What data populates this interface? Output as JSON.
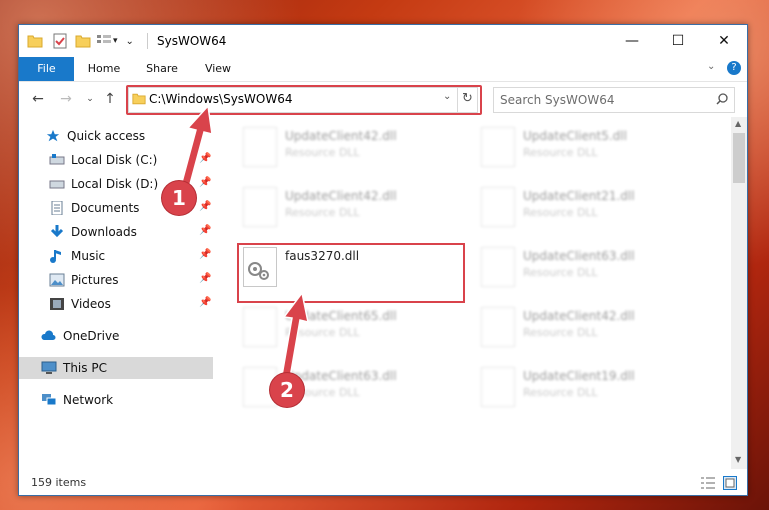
{
  "window": {
    "title": "SysWOW64",
    "controls": {
      "minimize": "—",
      "maximize": "☐",
      "close": "✕"
    }
  },
  "ribbon": {
    "tabs": [
      "File",
      "Home",
      "Share",
      "View"
    ],
    "help_icon": "?"
  },
  "nav": {
    "address": "C:\\Windows\\SysWOW64",
    "search_placeholder": "Search SysWOW64"
  },
  "sidebar": {
    "quick_access": "Quick access",
    "items": [
      {
        "label": "Local Disk (C:)",
        "icon": "drive-icon",
        "pinned": true
      },
      {
        "label": "Local Disk (D:)",
        "icon": "drive-icon",
        "pinned": true
      },
      {
        "label": "Documents",
        "icon": "documents-icon",
        "pinned": true
      },
      {
        "label": "Downloads",
        "icon": "downloads-icon",
        "pinned": true
      },
      {
        "label": "Music",
        "icon": "music-icon",
        "pinned": true
      },
      {
        "label": "Pictures",
        "icon": "pictures-icon",
        "pinned": true
      },
      {
        "label": "Videos",
        "icon": "videos-icon",
        "pinned": true
      }
    ],
    "onedrive": "OneDrive",
    "this_pc": "This PC",
    "network": "Network"
  },
  "files": {
    "left": [
      {
        "name": "UpdateClient42.dll",
        "type": "Resource DLL"
      },
      {
        "name": "UpdateClient42.dll",
        "type": "Resource DLL"
      },
      {
        "name": "faus3270.dll",
        "type": ""
      },
      {
        "name": "UpdateClient65.dll",
        "type": "Resource DLL"
      },
      {
        "name": "UpdateClient63.dll",
        "type": "Resource DLL"
      }
    ],
    "right": [
      {
        "name": "UpdateClient5.dll",
        "type": "Resource DLL"
      },
      {
        "name": "UpdateClient21.dll",
        "type": "Resource DLL"
      },
      {
        "name": "UpdateClient63.dll",
        "type": "Resource DLL"
      },
      {
        "name": "UpdateClient42.dll",
        "type": "Resource DLL"
      },
      {
        "name": "UpdateClient19.dll",
        "type": "Resource DLL"
      }
    ]
  },
  "status": {
    "count": "159 items"
  },
  "annotations": {
    "step1": "1",
    "step2": "2"
  },
  "colors": {
    "accent": "#1979ca",
    "highlight": "#d9434b"
  }
}
